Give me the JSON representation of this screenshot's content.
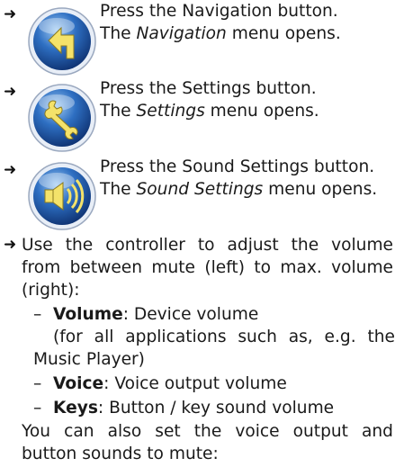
{
  "steps": [
    {
      "icon": "navigation-arrow-icon",
      "instruction": "Press the Navigation button.",
      "result_prefix": "The ",
      "result_menu": "Navigation",
      "result_suffix": " menu opens."
    },
    {
      "icon": "settings-wrench-icon",
      "instruction": "Press the Settings button.",
      "result_prefix": "The ",
      "result_menu": "Settings",
      "result_suffix": " menu opens."
    },
    {
      "icon": "sound-speaker-icon",
      "instruction": "Press the Sound Settings button.",
      "result_prefix": "The ",
      "result_menu": "Sound Settings",
      "result_suffix": " menu opens."
    }
  ],
  "arrow_symbol": "➜",
  "controller_step": {
    "line1": "Use the controller to adjust the volume",
    "line2": "from between mute (left) to max. volume",
    "line3": "(right):"
  },
  "volume_items": [
    {
      "dash": "–",
      "label": "Volume",
      "desc": ": Device volume",
      "extra_line1": "(for all applications such as, e.g. the",
      "extra_line2": "Music Player)"
    },
    {
      "dash": "–",
      "label": "Voice",
      "desc": ": Voice output volume"
    },
    {
      "dash": "–",
      "label": "Keys",
      "desc": ": Button / key sound volume"
    }
  ],
  "mute_note": {
    "line1": "You can also set the voice output and",
    "line2": "button sounds to mute:"
  },
  "colors": {
    "icon_ring": "#2b63b5",
    "icon_inner": "#1e4f9c",
    "icon_highlight": "#7fb2ea",
    "icon_symbol": "#f4e26a"
  }
}
